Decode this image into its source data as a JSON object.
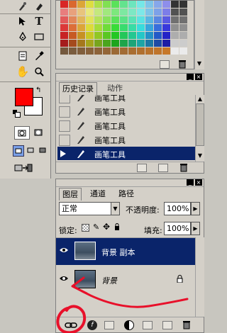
{
  "colors": {
    "bg": "#c8c6bf",
    "panel": "#d4d0c8",
    "selection": "#0a246a",
    "foreground_swatch": "#ff0000",
    "annotation": "#e8102a"
  },
  "toolbox": {
    "icons": [
      "history-brush-icon",
      "eraser-icon",
      "move-select-icon",
      "type-icon",
      "pen-icon",
      "rectangle-icon",
      "notes-icon",
      "eyedropper-icon",
      "hand-icon",
      "zoom-icon",
      "swap-colors-icon",
      "default-colors-icon",
      "standard-mode-icon",
      "quickmask-mode-icon",
      "screen-mode-standard-icon",
      "screen-mode-menubar-icon",
      "screen-mode-full-icon",
      "jump-to-imageready-icon"
    ]
  },
  "history": {
    "tab_active": "历史记录",
    "tab_inactive": "动作",
    "rows": [
      {
        "label": "画笔工具"
      },
      {
        "label": "画笔工具"
      },
      {
        "label": "画笔工具"
      },
      {
        "label": "画笔工具"
      },
      {
        "label": "画笔工具"
      }
    ]
  },
  "layers": {
    "tabs": [
      "图层",
      "通道",
      "路径"
    ],
    "blend_mode": "正常",
    "opacity_label": "不透明度:",
    "opacity_value": "100%",
    "lock_label": "锁定:",
    "fill_label": "填充:",
    "fill_value": "100%",
    "items": [
      {
        "name": "背景 副本",
        "selected": true
      },
      {
        "name": "背景",
        "selected": false,
        "locked": true
      }
    ]
  }
}
